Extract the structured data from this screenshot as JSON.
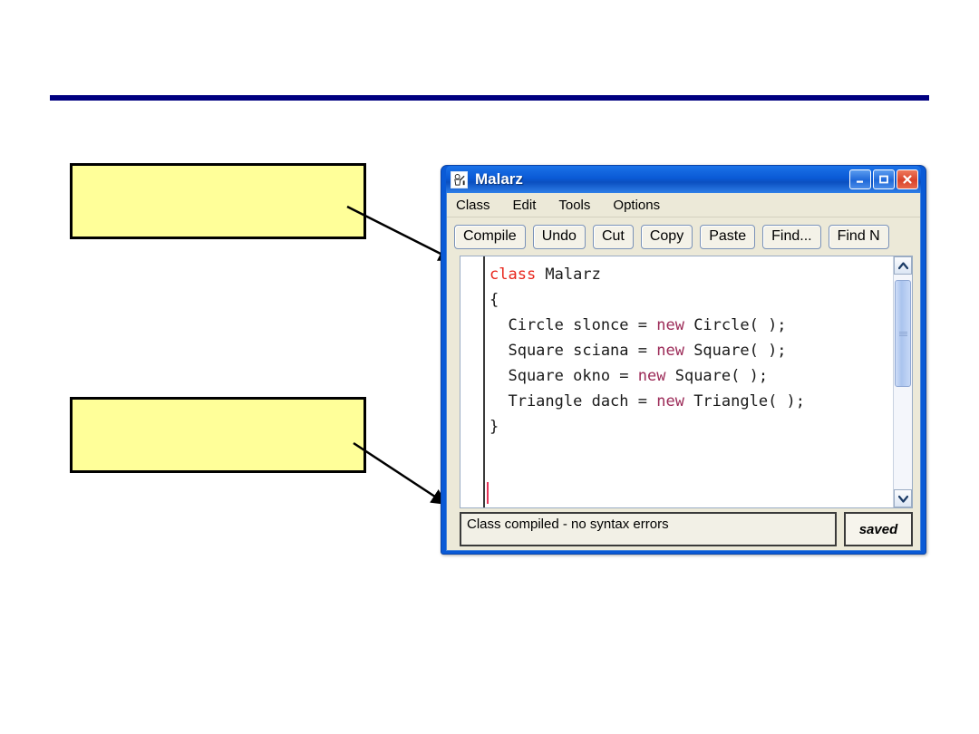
{
  "slide": {
    "divider_color": "#000080",
    "background_color": "#ffffff"
  },
  "callouts": [
    {
      "id": "callout-top",
      "text": "",
      "fill": "#ffff99",
      "border": "#000000"
    },
    {
      "id": "callout-bottom",
      "text": "",
      "fill": "#ffff99",
      "border": "#000000"
    }
  ],
  "window": {
    "title": "Malarz",
    "icon": "painter-app-icon",
    "frame_color": "#0a5ad6",
    "controls": {
      "minimize_label": "_",
      "maximize_label": "□",
      "close_label": "×"
    },
    "menu": [
      {
        "label": "Class"
      },
      {
        "label": "Edit"
      },
      {
        "label": "Tools"
      },
      {
        "label": "Options"
      }
    ],
    "toolbar": [
      {
        "label": "Compile"
      },
      {
        "label": "Undo"
      },
      {
        "label": "Cut"
      },
      {
        "label": "Copy"
      },
      {
        "label": "Paste"
      },
      {
        "label": "Find..."
      },
      {
        "label": "Find N"
      }
    ],
    "editor": {
      "keyword_class_color": "#e8261c",
      "keyword_new_color": "#9c2b58",
      "text_color": "#1a1a1a",
      "lines": [
        {
          "segments": [
            {
              "t": "class",
              "k": "class"
            },
            {
              "t": " Malarz"
            }
          ]
        },
        {
          "segments": [
            {
              "t": "{"
            }
          ]
        },
        {
          "segments": [
            {
              "t": "  Circle slonce = "
            },
            {
              "t": "new",
              "k": "new"
            },
            {
              "t": " Circle( );"
            }
          ]
        },
        {
          "segments": [
            {
              "t": "  Square sciana = "
            },
            {
              "t": "new",
              "k": "new"
            },
            {
              "t": " Square( );"
            }
          ]
        },
        {
          "segments": [
            {
              "t": "  Square okno = "
            },
            {
              "t": "new",
              "k": "new"
            },
            {
              "t": " Square( );"
            }
          ]
        },
        {
          "segments": [
            {
              "t": "  Triangle dach = "
            },
            {
              "t": "new",
              "k": "new"
            },
            {
              "t": " Triangle( );"
            }
          ]
        },
        {
          "segments": [
            {
              "t": "}"
            }
          ]
        }
      ]
    },
    "scrollbar": {
      "up_arrow": "▲",
      "down_arrow": "▼"
    },
    "status": {
      "message": "Class compiled - no syntax errors",
      "saved_label": "saved"
    }
  }
}
